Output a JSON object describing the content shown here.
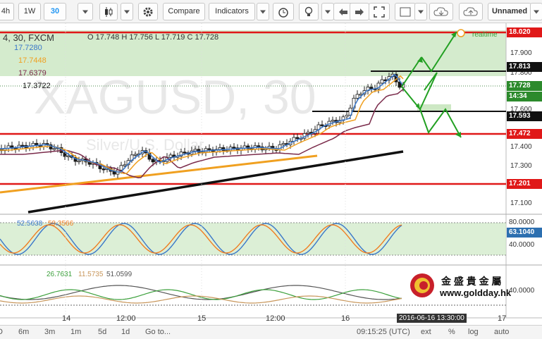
{
  "toolbar": {
    "interval_4h": "4h",
    "interval_1w": "1W",
    "interval_current": "30",
    "compare": "Compare",
    "indicators": "Indicators",
    "layout": "Unnamed"
  },
  "legend": {
    "symbol": "4, 30, FXCM",
    "ohlc": "O 17.748  H 17.756  L 17.719  C 17.728",
    "ma1": "17.7280",
    "ma2": "17.7448",
    "ma3": "17.6379",
    "ma4": "17.3722",
    "realtime": "realtime"
  },
  "watermark": {
    "symbol": "XAGUSD, 30",
    "desc": "Silver/U.S. Dollar"
  },
  "price_axis": {
    "ticks": [
      "17.900",
      "17.800",
      "17.600",
      "17.400",
      "17.300",
      "17.100"
    ],
    "tags": {
      "top": "18.020",
      "r1": "17.813",
      "current": "17.728",
      "countdown": "14:34",
      "s1": "17.593",
      "s2": "17.472",
      "s3": "17.201"
    }
  },
  "stoch": {
    "v1": "52.5638",
    "v2": "59.3566",
    "ticks": [
      "80.0000",
      "40.0000"
    ],
    "current": "63.1040"
  },
  "dmi": {
    "v1": "26.7631",
    "v2": "11.5735",
    "v3": "51.0599",
    "tick": "40.0000"
  },
  "logo": {
    "cn": "金 盛 貴 金 屬",
    "url": "www.goldday.hk"
  },
  "time_axis": {
    "labels": [
      "14",
      "12:00",
      "15",
      "12:00",
      "16",
      "17"
    ],
    "cursor": "2016-06-16 13:30:00"
  },
  "bottom": {
    "ranges": [
      "D",
      "6m",
      "3m",
      "1m",
      "5d",
      "1d"
    ],
    "goto": "Go to...",
    "clock": "09:15:25 (UTC)",
    "ext": "ext",
    "pct": "%",
    "log": "log",
    "auto": "auto"
  },
  "colors": {
    "support_line": "#e01818",
    "resistance_line": "#111111",
    "zone_fill": "#cde8c4",
    "arrow": "#22a022",
    "ma_blue": "#3b78c9",
    "ma_orange": "#f0a020",
    "ma_purple": "#7a2a4a"
  }
}
